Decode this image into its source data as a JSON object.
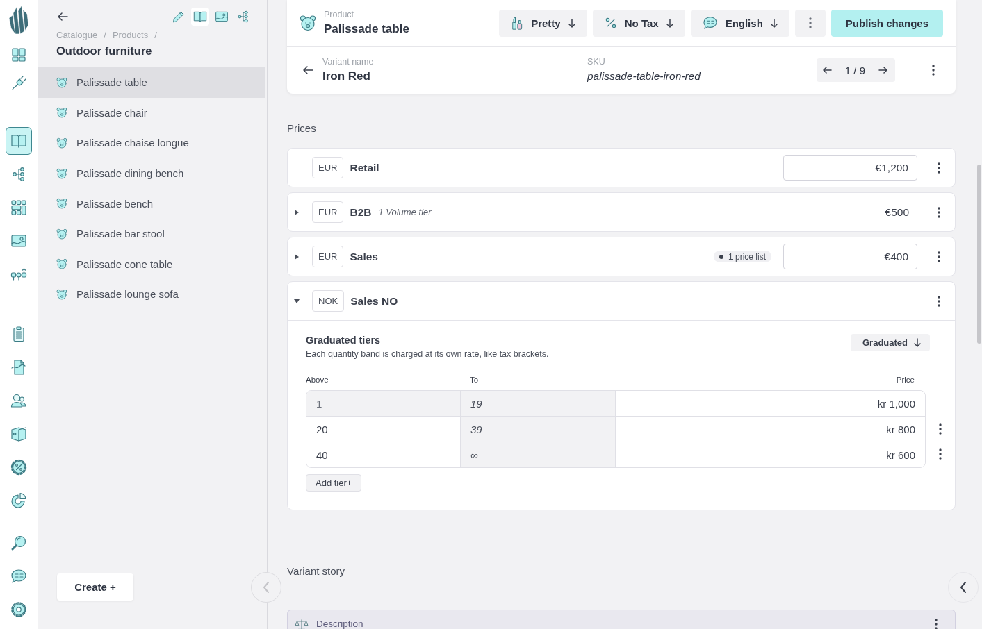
{
  "rail": {
    "groups": [
      {
        "items": [
          {
            "selected": false
          },
          {
            "selected": false
          }
        ]
      },
      {
        "items": [
          {
            "selected": true
          },
          {
            "selected": false
          },
          {
            "selected": false
          },
          {
            "selected": false
          },
          {
            "selected": false
          }
        ]
      },
      {
        "items": [
          {
            "selected": false
          },
          {
            "selected": false
          },
          {
            "selected": false
          },
          {
            "selected": false
          },
          {
            "selected": false
          },
          {
            "selected": false
          }
        ]
      },
      {
        "items": [
          {
            "selected": false
          },
          {
            "selected": false
          },
          {
            "selected": false
          }
        ]
      }
    ]
  },
  "sidebar": {
    "views": [
      {
        "selected": false
      },
      {
        "selected": true
      },
      {
        "selected": false
      },
      {
        "selected": false
      }
    ],
    "breadcrumb": {
      "items": [
        "Catalogue",
        "Products"
      ],
      "separator": "/"
    },
    "title": "Outdoor furniture",
    "items": [
      {
        "label": "Palissade table",
        "selected": true
      },
      {
        "label": "Palissade chair",
        "selected": false
      },
      {
        "label": "Palissade chaise longue",
        "selected": false
      },
      {
        "label": "Palissade dining bench",
        "selected": false
      },
      {
        "label": "Palissade bench",
        "selected": false
      },
      {
        "label": "Palissade bar stool",
        "selected": false
      },
      {
        "label": "Palissade cone table",
        "selected": false
      },
      {
        "label": "Palissade lounge sofa",
        "selected": false
      }
    ],
    "create_button": "Create +"
  },
  "header": {
    "product_label": "Product",
    "product_name": "Palissade table",
    "menus": [
      "Pretty",
      "No Tax",
      "English"
    ],
    "publish_button": "Publish changes",
    "variant_label": "Variant name",
    "variant_name": "Iron Red",
    "sku_label": "SKU",
    "sku": "palissade-table-iron-red",
    "pager": "1 / 9"
  },
  "prices": {
    "heading": "Prices",
    "rows": [
      {
        "currency": "EUR",
        "name": "Retail",
        "value": "€1,200",
        "editable": true
      },
      {
        "currency": "EUR",
        "name": "B2B",
        "note": "1 Volume tier",
        "value": "€500",
        "editable": false,
        "expanded": false
      },
      {
        "currency": "EUR",
        "name": "Sales",
        "badge": "1 price list",
        "value": "€400",
        "editable": true,
        "expanded": false
      },
      {
        "currency": "NOK",
        "name": "Sales NO",
        "expanded": true,
        "tiers": {
          "title": "Graduated tiers",
          "description": "Each quantity band is charged at its own rate, like tax brackets.",
          "mode": "Graduated",
          "columns": [
            "Above",
            "To",
            "Price"
          ],
          "rows": [
            {
              "above": "1",
              "to": "19",
              "price": "kr 1,000",
              "disabled": true
            },
            {
              "above": "20",
              "to": "39",
              "price": "kr 800",
              "disabled": false
            },
            {
              "above": "40",
              "to": "∞",
              "price": "kr 600",
              "disabled": false
            }
          ],
          "add_button": "Add tier+"
        }
      }
    ]
  },
  "variant_story": {
    "heading": "Variant story",
    "fields": [
      {
        "label": "Description"
      }
    ]
  }
}
